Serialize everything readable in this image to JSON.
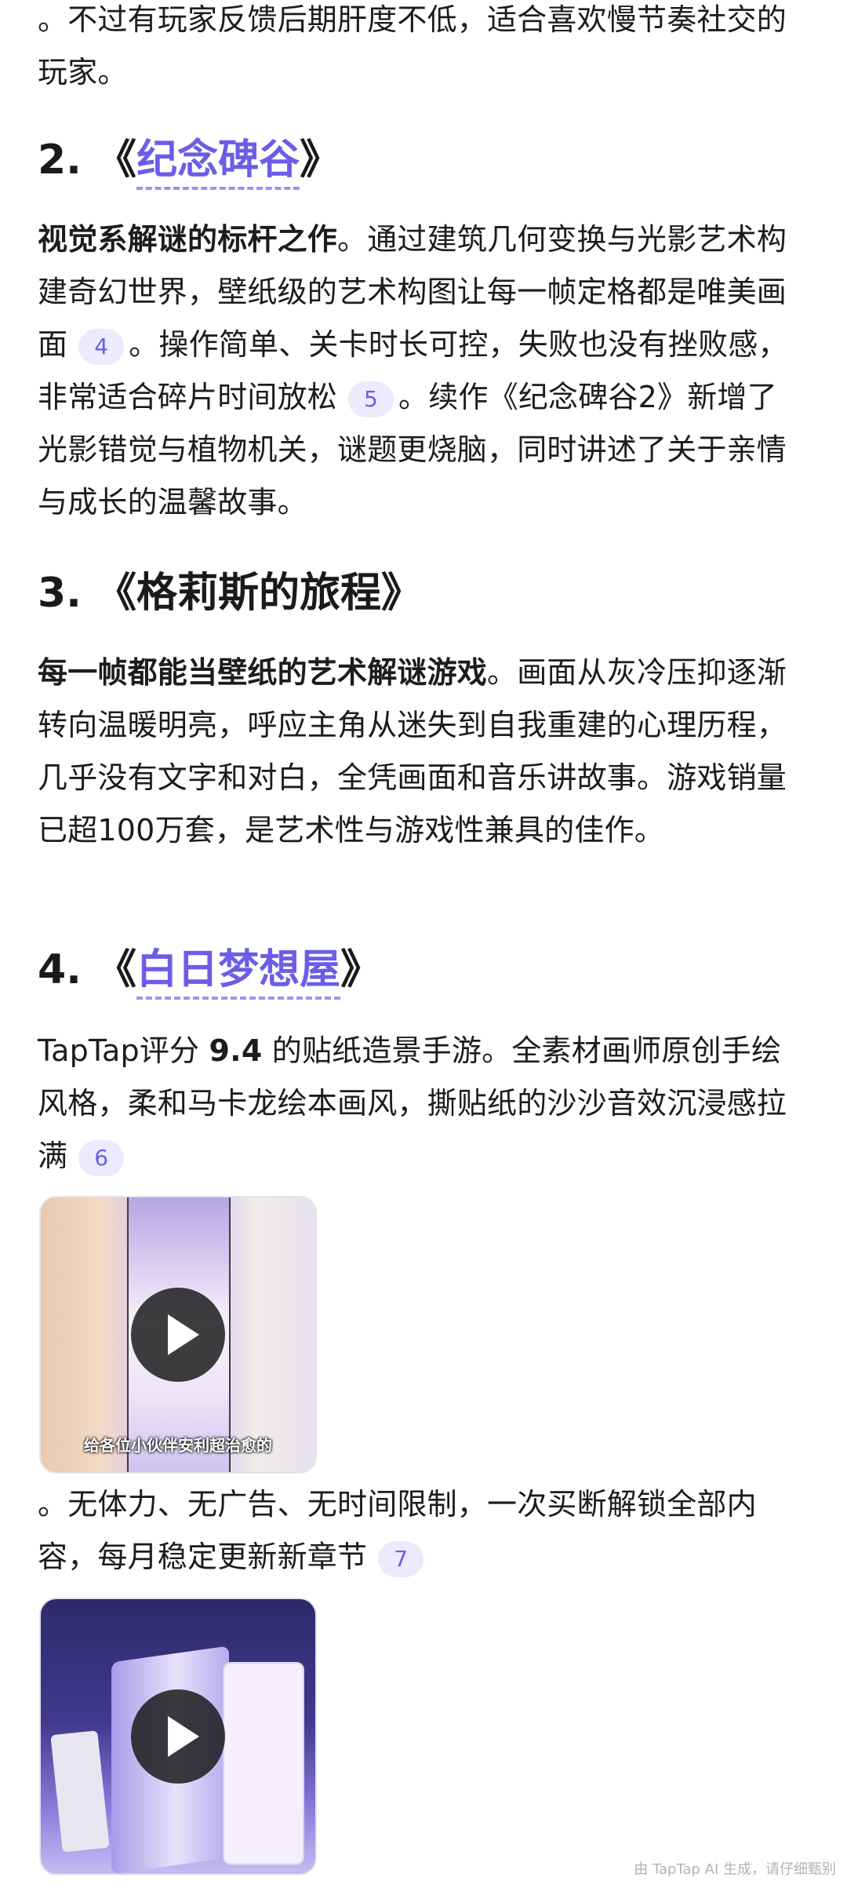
{
  "intro_tail": "。不过有玩家反馈后期肝度不低，适合喜欢慢节奏社交的玩家。",
  "items": [
    {
      "number": "2.",
      "open": "《",
      "name": "纪念碑谷",
      "close": "》",
      "lead": "视觉系解谜的标杆之作",
      "text_a": "。通过建筑几何变换与光影艺术构建奇幻世界，壁纸级的艺术构图让每一帧定格都是唯美画面",
      "cite_a": "4",
      "text_b": "。操作简单、关卡时长可控，失败也没有挫败感，非常适合碎片时间放松",
      "cite_b": "5",
      "text_c": "。续作《纪念碑谷2》新增了光影错觉与植物机关，谜题更烧脑，同时讲述了关于亲情与成长的温馨故事。"
    },
    {
      "title": "3. 《格莉斯的旅程》",
      "lead": "每一帧都能当壁纸的艺术解谜游戏",
      "text": "。画面从灰冷压抑逐渐转向温暖明亮，呼应主角从迷失到自我重建的心理历程，几乎没有文字和对白，全凭画面和音乐讲故事。游戏销量已超100万套，是艺术性与游戏性兼具的佳作。"
    },
    {
      "number": "4.",
      "open": "《",
      "name": "白日梦想屋",
      "close": "》",
      "text_pre": "TapTap评分 ",
      "score": "9.4",
      "text_a": " 的贴纸造景手游。全素材画师原创手绘风格，柔和马卡龙绘本画风，撕贴纸的沙沙音效沉浸感拉满",
      "cite_a": "6",
      "video1_caption": "给各位小伙伴安利超治愈的",
      "text_b": "。无体力、无广告、无时间限制，一次买断解锁全部内容，每月稳定更新新章节",
      "cite_b": "7"
    }
  ],
  "footer": "由 TapTap AI 生成，请仔细甄别",
  "colors": {
    "accent": "#6c5ce7",
    "cite_bg": "#ecebfd",
    "text": "#1c1c1c"
  }
}
